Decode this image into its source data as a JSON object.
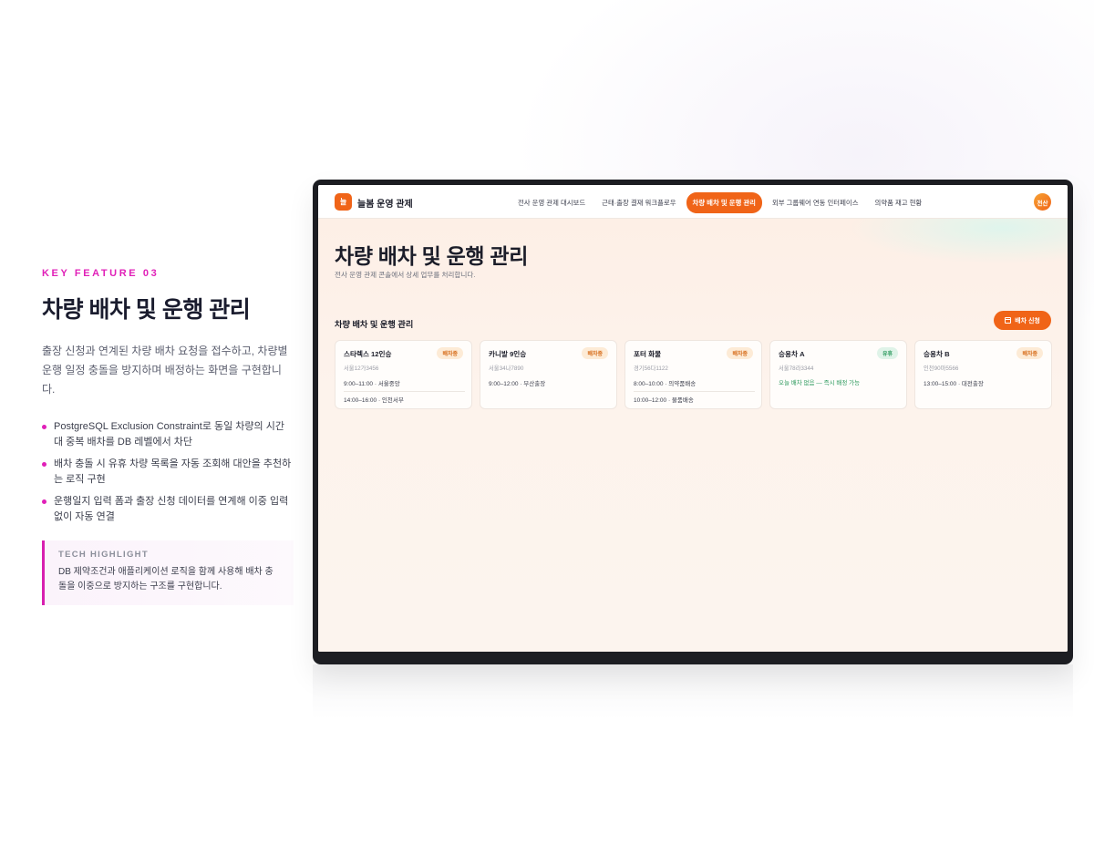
{
  "feature": {
    "kicker": "KEY FEATURE 03",
    "title": "차량 배차 및 운행 관리",
    "description": "출장 신청과 연계된 차량 배차 요청을 접수하고, 차량별 운행 일정 충돌을 방지하며 배정하는 화면을 구현합니다.",
    "bullets": [
      "PostgreSQL Exclusion Constraint로 동일 차량의 시간대 중복 배차를 DB 레벨에서 차단",
      "배차 충돌 시 유휴 차량 목록을 자동 조회해 대안을 추천하는 로직 구현",
      "운행일지 입력 폼과 출장 신청 데이터를 연계해 이중 입력 없이 자동 연결"
    ],
    "tech_label": "TECH HIGHLIGHT",
    "tech_text": "DB 제약조건과 애플리케이션 로직을 함께 사용해 배차 충돌을 이중으로 방지하는 구조를 구현합니다."
  },
  "app": {
    "logo_char": "늘",
    "brand": "늘봄 운영 관제",
    "nav": [
      {
        "label": "전사 운영 관제 대시보드",
        "active": false
      },
      {
        "label": "근태·출장 결재 워크플로우",
        "active": false
      },
      {
        "label": "차량 배차 및 운행 관리",
        "active": true
      },
      {
        "label": "외부 그룹웨어 연동 인터페이스",
        "active": false
      },
      {
        "label": "의약품 재고 현황",
        "active": false
      }
    ],
    "avatar": "전산"
  },
  "page": {
    "title": "차량 배차 및 운행 관리",
    "subtitle": "전사 운영 관제 콘솔에서 상세 업무를 처리합니다.",
    "section_title": "차량 배차 및 운행 관리",
    "action_label": "배차 신청",
    "action_icon": "calendar-icon"
  },
  "vehicles": [
    {
      "name": "스타렉스 12인승",
      "status": "배차중",
      "plate": "서울12가3456",
      "slots": [
        "9:00–11:00 · 서울중앙",
        "14:00–16:00 · 인천서부"
      ]
    },
    {
      "name": "카니발 9인승",
      "status": "배차중",
      "plate": "서울34나7890",
      "slots": [
        "9:00–12:00 · 부산출장"
      ]
    },
    {
      "name": "포터 화물",
      "status": "배차중",
      "plate": "경기56다1122",
      "slots": [
        "8:00–10:00 · 의약품배송",
        "10:00–12:00 · 물품배송"
      ]
    },
    {
      "name": "승용차 A",
      "status": "유휴",
      "plate": "서울78라3344",
      "slots": [],
      "empty_note": "오늘 배차 없음 — 즉시 배정 가능"
    },
    {
      "name": "승용차 B",
      "status": "배차중",
      "plate": "인천90마5566",
      "slots": [
        "13:00–15:00 · 대전출장"
      ]
    }
  ],
  "colors": {
    "accent": "#f06418",
    "feature_accent": "#e020b8",
    "idle_green": "#2d9a5e",
    "busy_badge_bg": "#fdebd6"
  }
}
